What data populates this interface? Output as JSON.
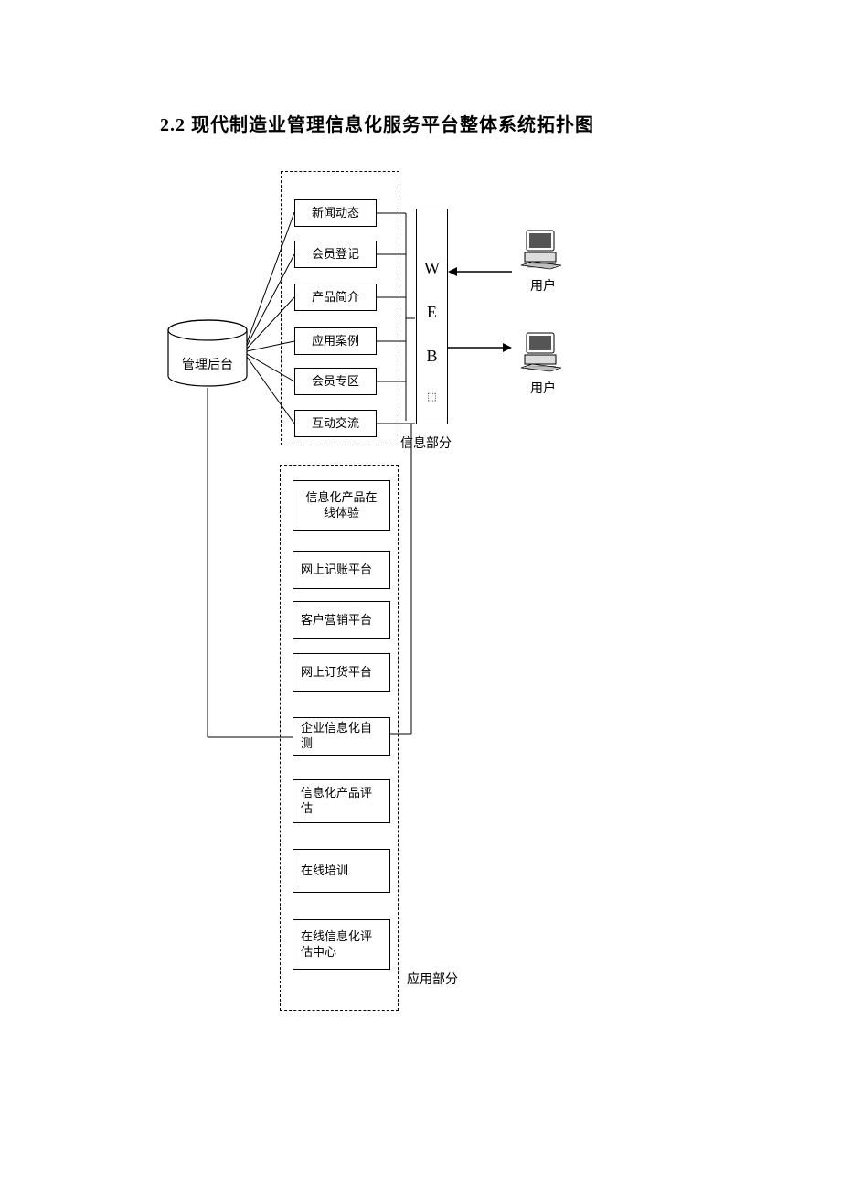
{
  "title": "2.2 现代制造业管理信息化服务平台整体系统拓扑图",
  "admin_label": "管理后台",
  "info_section_label": "信息部分",
  "app_section_label": "应用部分",
  "web_letters": {
    "w": "W",
    "e": "E",
    "b": "B"
  },
  "user_label_1": "用户",
  "user_label_2": "用户",
  "info_boxes": [
    "新闻动态",
    "会员登记",
    "产品简介",
    "应用案例",
    "会员专区",
    "互动交流"
  ],
  "app_boxes": [
    "信息化产品在线体验",
    "网上记账平台",
    "客户营销平台",
    "网上订货平台",
    "企业信息化自测",
    "信息化产品评估",
    "在线培训",
    "在线信息化评估中心"
  ]
}
